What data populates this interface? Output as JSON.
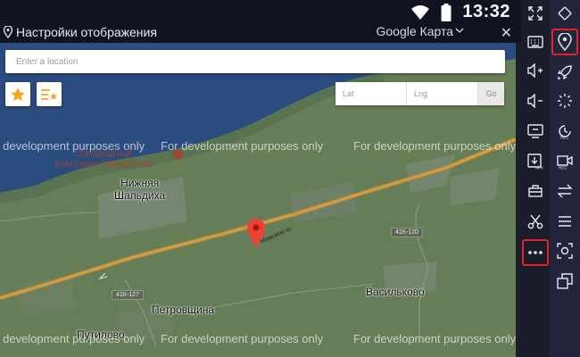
{
  "status_bar": {
    "time": "13:32"
  },
  "dialog": {
    "title": "Настройки отображения",
    "map_provider": "Google Карта",
    "close_label": "✕"
  },
  "map": {
    "search_placeholder": "Enter a location",
    "lat_placeholder": "Lat",
    "lng_placeholder": "Lng",
    "go_label": "Go",
    "watermark": "For development purposes only",
    "poi_label_line1": "Загородный",
    "poi_label_line2": "комплекс Тимофеево",
    "place_labels": {
      "nizhnyaya_line1": "Нижняя",
      "nizhnyaya_line2": "Шальдиха",
      "petrovshchina": "Петровщина",
      "vasilkovo": "Васильково",
      "putilovo": "Путилово"
    },
    "road_labels": {
      "shield_120": "41К-120",
      "shield_127": "41К-127",
      "road_name": "Мамское ш."
    }
  },
  "toolbar_left": [
    "fullscreen-icon",
    "keyboard-icon",
    "volume-up-icon",
    "volume-down-icon",
    "screen-icon",
    "apk-install-icon",
    "toolbox-icon",
    "scissors-icon",
    "more-icon"
  ],
  "toolbar_right": [
    "rotate-icon",
    "location-icon",
    "rocket-icon",
    "loading-icon",
    "record-icon",
    "video-record-icon",
    "sync-icon",
    "menu-icon",
    "screenshot-icon",
    "multi-window-icon"
  ],
  "colors": {
    "highlight": "#e0232e",
    "map_green": "#667e57",
    "water": "#2b4c7e",
    "marker": "#ea4335"
  }
}
